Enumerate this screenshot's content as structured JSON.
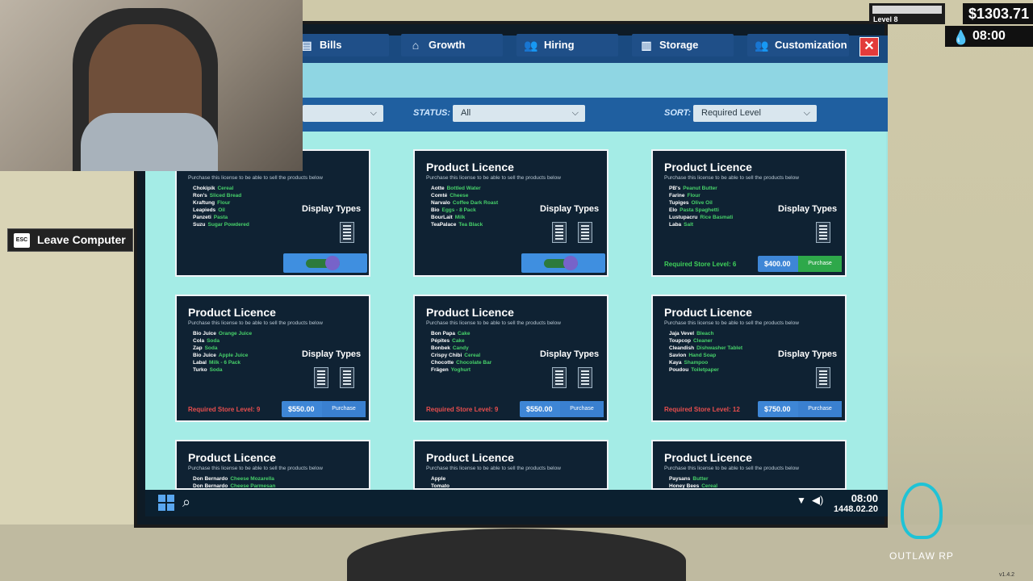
{
  "tabs": [
    {
      "label": "Bills",
      "icon": "receipt-icon"
    },
    {
      "label": "Growth",
      "icon": "store-icon"
    },
    {
      "label": "Hiring",
      "icon": "people-icon"
    },
    {
      "label": "Storage",
      "icon": "shelf-icon"
    },
    {
      "label": "Customization",
      "icon": "people-icon"
    }
  ],
  "filters": {
    "status_label": "STATUS:",
    "status_value": "All",
    "sort_label": "SORT:",
    "sort_value": "Required Level"
  },
  "cards": [
    {
      "title": "Product Licence",
      "sub": "Purchase this license to be able to sell the products below",
      "items": [
        [
          "Chokipik",
          "Cereal"
        ],
        [
          "Ron's",
          "Sliced Bread"
        ],
        [
          "Kraftung",
          "Flour"
        ],
        [
          "Leapieds",
          "Oil"
        ],
        [
          "Panzeti",
          "Pasta"
        ],
        [
          "Suzu",
          "Sugar Powdered"
        ]
      ],
      "display": "Display Types",
      "state": "owned"
    },
    {
      "title": "Product Licence",
      "sub": "Purchase this license to be able to sell the products below",
      "items": [
        [
          "Aotte",
          "Bottled Water"
        ],
        [
          "Comté",
          "Cheese"
        ],
        [
          "Narvalo",
          "Coffee Dark Roast"
        ],
        [
          "Bio",
          "Eggs - 8 Pack"
        ],
        [
          "BourLait",
          "Milk"
        ],
        [
          "TeaPalace",
          "Tea Black"
        ]
      ],
      "display": "Display Types",
      "state": "owned"
    },
    {
      "title": "Product Licence",
      "sub": "Purchase this license to be able to sell the products below",
      "items": [
        [
          "PB's",
          "Peanut Butter"
        ],
        [
          "Farine",
          "Flour"
        ],
        [
          "Tupiges",
          "Olive Oil"
        ],
        [
          "Elo",
          "Pasta Spaghetti"
        ],
        [
          "Lustupacru",
          "Rice Basmati"
        ],
        [
          "Laba",
          "Salt"
        ]
      ],
      "display": "Display Types",
      "state": "buy",
      "req": "Required Store Level: 6",
      "req_ok": true,
      "price": "$400.00",
      "buy": "Purchase"
    },
    {
      "title": "Product Licence",
      "sub": "Purchase this license to be able to sell the products below",
      "items": [
        [
          "Bio Juice",
          "Orange Juice"
        ],
        [
          "Cola",
          "Soda"
        ],
        [
          "Zap",
          "Soda"
        ],
        [
          "Bio Juice",
          "Apple Juice"
        ],
        [
          "Labal",
          "Milk - 6 Pack"
        ],
        [
          "Turko",
          "Soda"
        ]
      ],
      "display": "Display Types",
      "state": "buy",
      "req": "Required Store Level: 9",
      "req_ok": false,
      "price": "$550.00",
      "buy": "Purchase"
    },
    {
      "title": "Product Licence",
      "sub": "Purchase this license to be able to sell the products below",
      "items": [
        [
          "Bon Papa",
          "Cake"
        ],
        [
          "Pépites",
          "Cake"
        ],
        [
          "Bonbek",
          "Candy"
        ],
        [
          "Crispy Chibi",
          "Cereal"
        ],
        [
          "Chocotte",
          "Chocolate Bar"
        ],
        [
          "Frägen",
          "Yoghurt"
        ]
      ],
      "display": "Display Types",
      "state": "buy",
      "req": "Required Store Level: 9",
      "req_ok": false,
      "price": "$550.00",
      "buy": "Purchase"
    },
    {
      "title": "Product Licence",
      "sub": "Purchase this license to be able to sell the products below",
      "items": [
        [
          "Jaja Vevel",
          "Bleach"
        ],
        [
          "Toupcop",
          "Cleaner"
        ],
        [
          "Cleandish",
          "Dishwasher Tablet"
        ],
        [
          "Savion",
          "Hand Soap"
        ],
        [
          "Kaya",
          "Shampoo"
        ],
        [
          "Poudou",
          "Toiletpaper"
        ]
      ],
      "display": "Display Types",
      "state": "buy",
      "req": "Required Store Level: 12",
      "req_ok": false,
      "price": "$750.00",
      "buy": "Purchase"
    },
    {
      "title": "Product Licence",
      "sub": "Purchase this license to be able to sell the products below",
      "items": [
        [
          "Don Bernardo",
          "Cheese Mozarella"
        ],
        [
          "Don Bernardo",
          "Cheese Parmesan"
        ]
      ],
      "display": "",
      "state": "partial"
    },
    {
      "title": "Product Licence",
      "sub": "Purchase this license to be able to sell the products below",
      "items": [
        [
          "Apple",
          ""
        ],
        [
          "Tomato",
          ""
        ]
      ],
      "display": "",
      "state": "partial"
    },
    {
      "title": "Product Licence",
      "sub": "Purchase this license to be able to sell the products below",
      "items": [
        [
          "Paysans",
          "Butter"
        ],
        [
          "Honey Bees",
          "Cereal"
        ]
      ],
      "display": "",
      "state": "partial"
    }
  ],
  "taskbar": {
    "time": "08:00",
    "date": "1448.02.20"
  },
  "hud": {
    "level": "Level 8",
    "money": "$1303.71",
    "time": "08:00"
  },
  "leave": {
    "key": "ESC",
    "label": "Leave Computer"
  },
  "logo": {
    "text": "OUTLAW RP"
  },
  "version": "v1.4.2",
  "colors": {
    "accent": "#1f5fa0",
    "ok": "#3fd35a",
    "bad": "#e84e4e",
    "screen": "#9fe6e3"
  }
}
